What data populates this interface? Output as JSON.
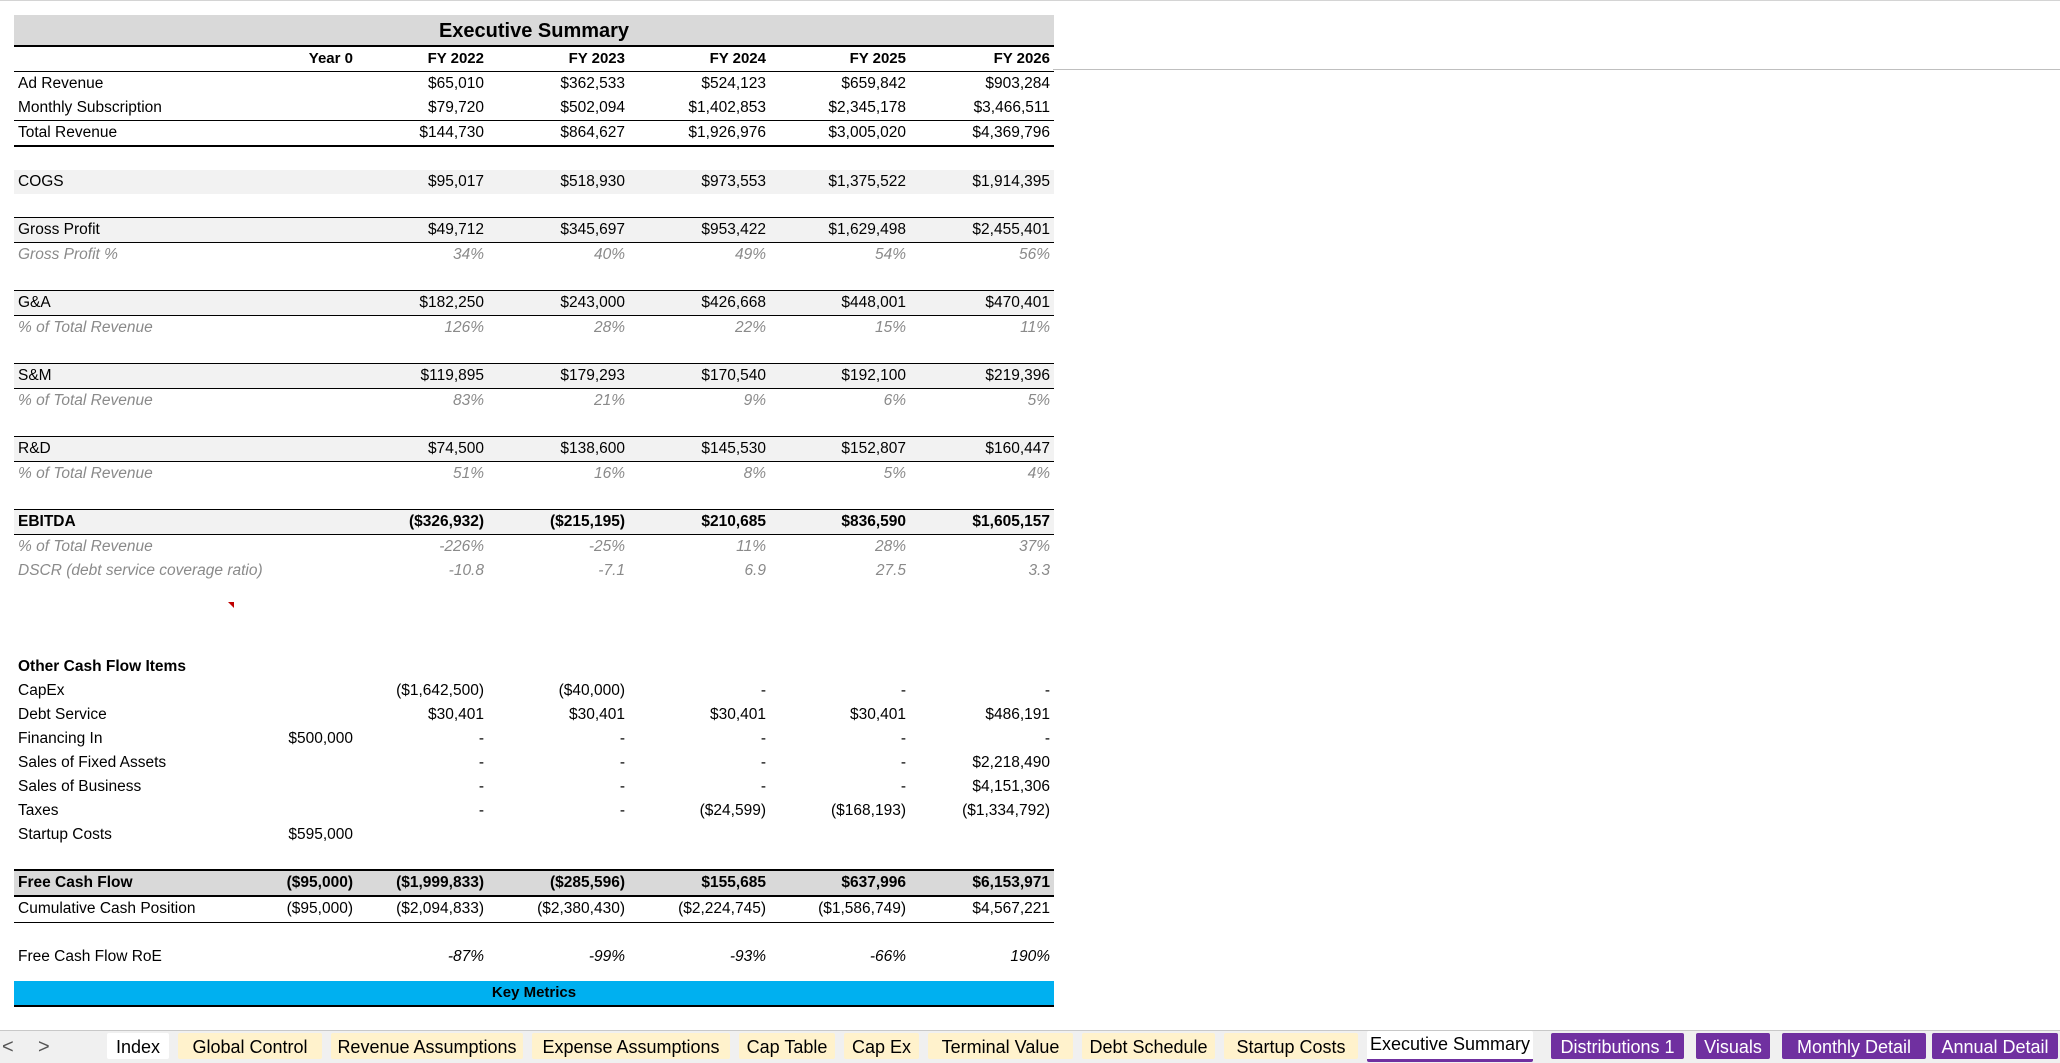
{
  "title": "Executive Summary",
  "columns": [
    "Year 0",
    "FY 2022",
    "FY 2023",
    "FY 2024",
    "FY 2025",
    "FY 2026"
  ],
  "revenue": [
    {
      "label": "Ad Revenue",
      "vals": [
        "",
        "$65,010",
        "$362,533",
        "$524,123",
        "$659,842",
        "$903,284"
      ]
    },
    {
      "label": "Monthly Subscription",
      "vals": [
        "",
        "$79,720",
        "$502,094",
        "$1,402,853",
        "$2,345,178",
        "$3,466,511"
      ]
    },
    {
      "label": "Total Revenue",
      "vals": [
        "",
        "$144,730",
        "$864,627",
        "$1,926,976",
        "$3,005,020",
        "$4,369,796"
      ]
    }
  ],
  "cogs": {
    "label": "COGS",
    "vals": [
      "",
      "$95,017",
      "$518,930",
      "$973,553",
      "$1,375,522",
      "$1,914,395"
    ]
  },
  "gross_profit": {
    "label": "Gross Profit",
    "vals": [
      "",
      "$49,712",
      "$345,697",
      "$953,422",
      "$1,629,498",
      "$2,455,401"
    ]
  },
  "gross_profit_pct": {
    "label": "Gross Profit %",
    "vals": [
      "",
      "34%",
      "40%",
      "49%",
      "54%",
      "56%"
    ]
  },
  "ga": {
    "label": "G&A",
    "vals": [
      "",
      "$182,250",
      "$243,000",
      "$426,668",
      "$448,001",
      "$470,401"
    ]
  },
  "ga_pct": {
    "label": "% of Total Revenue",
    "vals": [
      "",
      "126%",
      "28%",
      "22%",
      "15%",
      "11%"
    ]
  },
  "sm": {
    "label": "S&M",
    "vals": [
      "",
      "$119,895",
      "$179,293",
      "$170,540",
      "$192,100",
      "$219,396"
    ]
  },
  "sm_pct": {
    "label": "% of Total Revenue",
    "vals": [
      "",
      "83%",
      "21%",
      "9%",
      "6%",
      "5%"
    ]
  },
  "rd": {
    "label": "R&D",
    "vals": [
      "",
      "$74,500",
      "$138,600",
      "$145,530",
      "$152,807",
      "$160,447"
    ]
  },
  "rd_pct": {
    "label": "% of Total Revenue",
    "vals": [
      "",
      "51%",
      "16%",
      "8%",
      "5%",
      "4%"
    ]
  },
  "ebitda": {
    "label": "EBITDA",
    "vals": [
      "",
      "($326,932)",
      "($215,195)",
      "$210,685",
      "$836,590",
      "$1,605,157"
    ]
  },
  "ebitda_pct": {
    "label": "% of Total Revenue",
    "vals": [
      "",
      "-226%",
      "-25%",
      "11%",
      "28%",
      "37%"
    ]
  },
  "dscr": {
    "label": "DSCR (debt service coverage ratio)",
    "vals": [
      "",
      "-10.8",
      "-7.1",
      "6.9",
      "27.5",
      "3.3"
    ]
  },
  "other_heading": "Other Cash Flow Items",
  "other": [
    {
      "label": "CapEx",
      "vals": [
        "",
        "($1,642,500)",
        "($40,000)",
        "-",
        "-",
        "-"
      ]
    },
    {
      "label": "Debt Service",
      "vals": [
        "",
        "$30,401",
        "$30,401",
        "$30,401",
        "$30,401",
        "$486,191"
      ]
    },
    {
      "label": "Financing In",
      "vals": [
        "$500,000",
        "-",
        "-",
        "-",
        "-",
        "-"
      ]
    },
    {
      "label": "Sales of Fixed Assets",
      "vals": [
        "",
        "-",
        "-",
        "-",
        "-",
        "$2,218,490"
      ]
    },
    {
      "label": "Sales of Business",
      "vals": [
        "",
        "-",
        "-",
        "-",
        "-",
        "$4,151,306"
      ]
    },
    {
      "label": "Taxes",
      "vals": [
        "",
        "-",
        "-",
        "($24,599)",
        "($168,193)",
        "($1,334,792)"
      ]
    },
    {
      "label": "Startup Costs",
      "vals": [
        "$595,000",
        "",
        "",
        "",
        "",
        ""
      ]
    }
  ],
  "fcf": {
    "label": "Free Cash Flow",
    "vals": [
      "($95,000)",
      "($1,999,833)",
      "($285,596)",
      "$155,685",
      "$637,996",
      "$6,153,971"
    ]
  },
  "cum_cash": {
    "label": "Cumulative Cash Position",
    "vals": [
      "($95,000)",
      "($2,094,833)",
      "($2,380,430)",
      "($2,224,745)",
      "($1,586,749)",
      "$4,567,221"
    ]
  },
  "fcf_roe": {
    "label": "Free Cash Flow RoE",
    "vals": [
      "",
      "-87%",
      "-99%",
      "-93%",
      "-66%",
      "190%"
    ]
  },
  "key_metrics": "Key Metrics",
  "tabs": [
    "Index",
    "Global Control",
    "Revenue Assumptions",
    "Expense Assumptions",
    "Cap Table",
    "Cap Ex",
    "Terminal Value",
    "Debt Schedule",
    "Startup Costs",
    "Executive Summary",
    "Distributions 1",
    "Visuals",
    "Monthly Detail",
    "Annual Detail"
  ],
  "nav": {
    "prev": "<",
    "next": ">"
  },
  "colors": {
    "accent_purple": "#7030a0",
    "tab_yellow": "#fff2cc",
    "key_metrics_blue": "#00b0f0",
    "header_gray": "#d9d9d9"
  }
}
